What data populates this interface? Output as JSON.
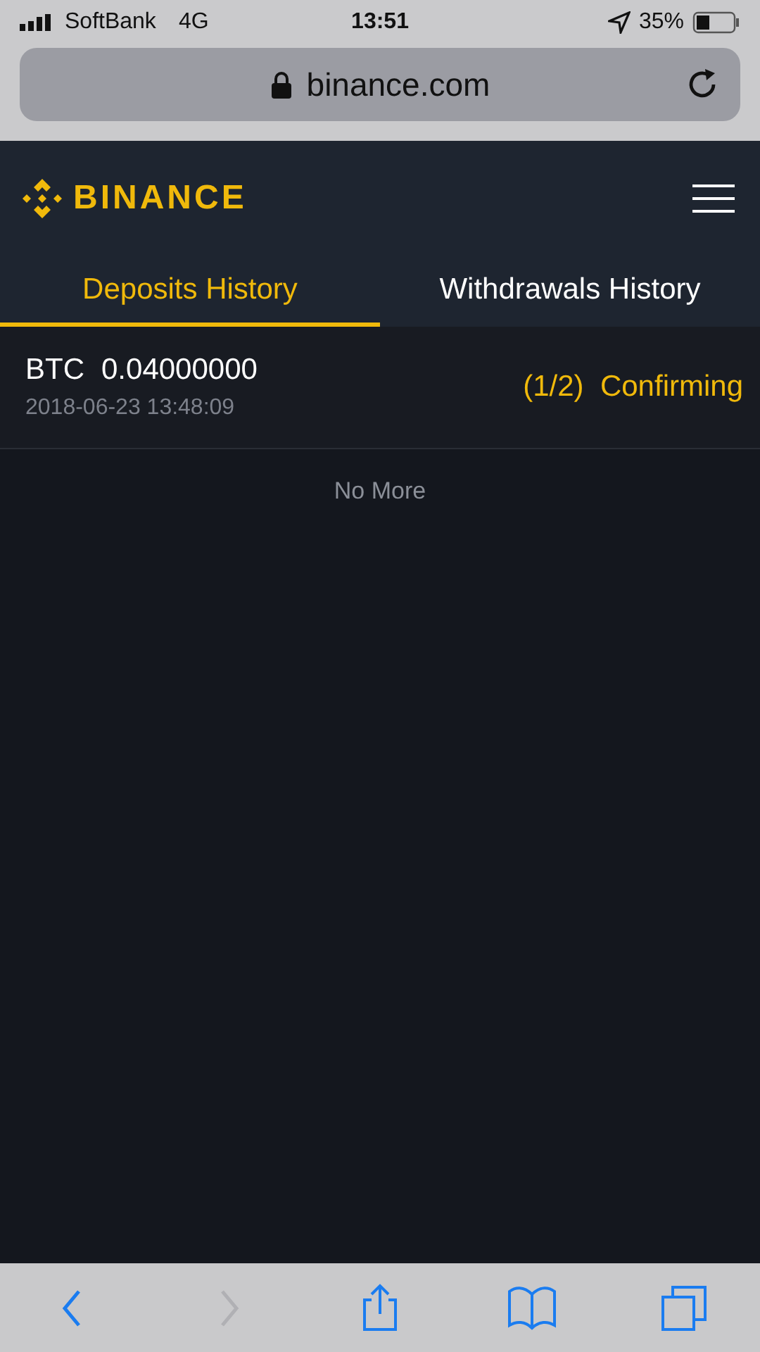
{
  "status_bar": {
    "carrier": "SoftBank",
    "network": "4G",
    "time": "13:51",
    "battery_text": "35%"
  },
  "address_bar": {
    "url": "binance.com"
  },
  "header": {
    "logo_text": "BINANCE"
  },
  "tabs": [
    {
      "label": "Deposits History",
      "selected": true
    },
    {
      "label": "Withdrawals History",
      "selected": false
    }
  ],
  "deposits": [
    {
      "coin": "BTC",
      "amount": "0.04000000",
      "time": "2018-06-23 13:48:09",
      "status": "(1/2)  Confirming"
    }
  ],
  "list_end": "No More",
  "toolbar": [
    {
      "kind": "back",
      "disabled": false
    },
    {
      "kind": "forward",
      "disabled": true
    },
    {
      "kind": "share",
      "disabled": false
    },
    {
      "kind": "bookmarks",
      "disabled": false
    },
    {
      "kind": "tabs",
      "disabled": false
    }
  ]
}
